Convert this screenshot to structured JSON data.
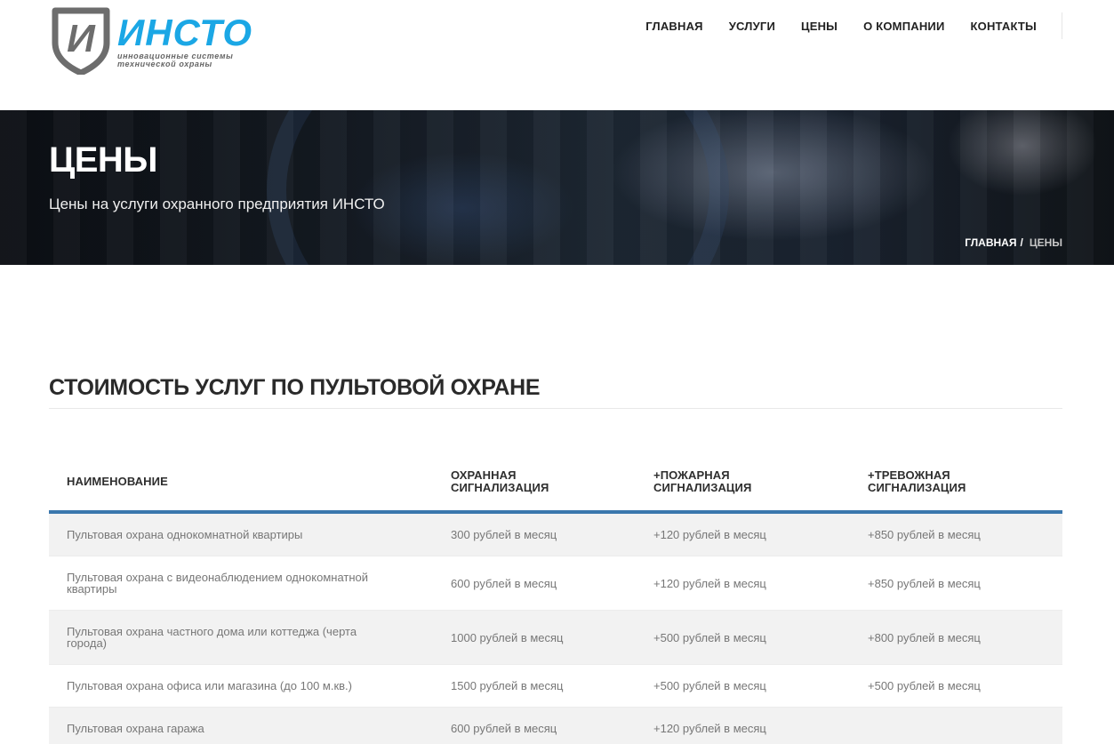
{
  "brand": {
    "name": "ИНСТО",
    "tagline_line1": "инновационные системы",
    "tagline_line2": "технической охраны",
    "shield_letter": "И",
    "colors": {
      "accent": "#1ba7e5",
      "shield": "#6d6d6d",
      "table_border": "#3a77ad"
    }
  },
  "nav": {
    "items": [
      {
        "label": "ГЛАВНАЯ"
      },
      {
        "label": "УСЛУГИ"
      },
      {
        "label": "ЦЕНЫ"
      },
      {
        "label": "О КОМПАНИИ"
      },
      {
        "label": "КОНТАКТЫ"
      }
    ]
  },
  "banner": {
    "title": "ЦЕНЫ",
    "subtitle": "Цены на услуги охранного предприятия ИНСТО",
    "breadcrumb": {
      "home": "ГЛАВНАЯ",
      "separator": "/",
      "current": "ЦЕНЫ"
    }
  },
  "section": {
    "title": "СТОИМОСТЬ УСЛУГ ПО ПУЛЬТОВОЙ ОХРАНЕ"
  },
  "table": {
    "headers": [
      {
        "line1": "НАИМЕНОВАНИЕ",
        "line2": ""
      },
      {
        "line1": "ОХРАННАЯ",
        "line2": "СИГНАЛИЗАЦИЯ"
      },
      {
        "line1": "+ПОЖАРНАЯ",
        "line2": "СИГНАЛИЗАЦИЯ"
      },
      {
        "line1": "+ТРЕВОЖНАЯ",
        "line2": "СИГНАЛИЗАЦИЯ"
      }
    ],
    "rows": [
      {
        "name": "Пультовая охрана однокомнатной квартиры",
        "security": "300 рублей в месяц",
        "fire": "+120 рублей в месяц",
        "alarm": "+850 рублей в месяц"
      },
      {
        "name": "Пультовая охрана с видеонаблюдением однокомнатной квартиры",
        "security": "600 рублей в месяц",
        "fire": "+120 рублей в месяц",
        "alarm": "+850 рублей в месяц"
      },
      {
        "name": "Пультовая охрана частного дома или коттеджа (черта города)",
        "security": "1000 рублей в месяц",
        "fire": "+500 рублей в месяц",
        "alarm": "+800 рублей в месяц"
      },
      {
        "name": "Пультовая охрана офиса или магазина (до 100 м.кв.)",
        "security": "1500 рублей в месяц",
        "fire": "+500 рублей в месяц",
        "alarm": "+500 рублей в месяц"
      },
      {
        "name": "Пультовая охрана гаража",
        "security": "600 рублей в месяц",
        "fire": "+120 рублей в месяц",
        "alarm": ""
      }
    ]
  }
}
